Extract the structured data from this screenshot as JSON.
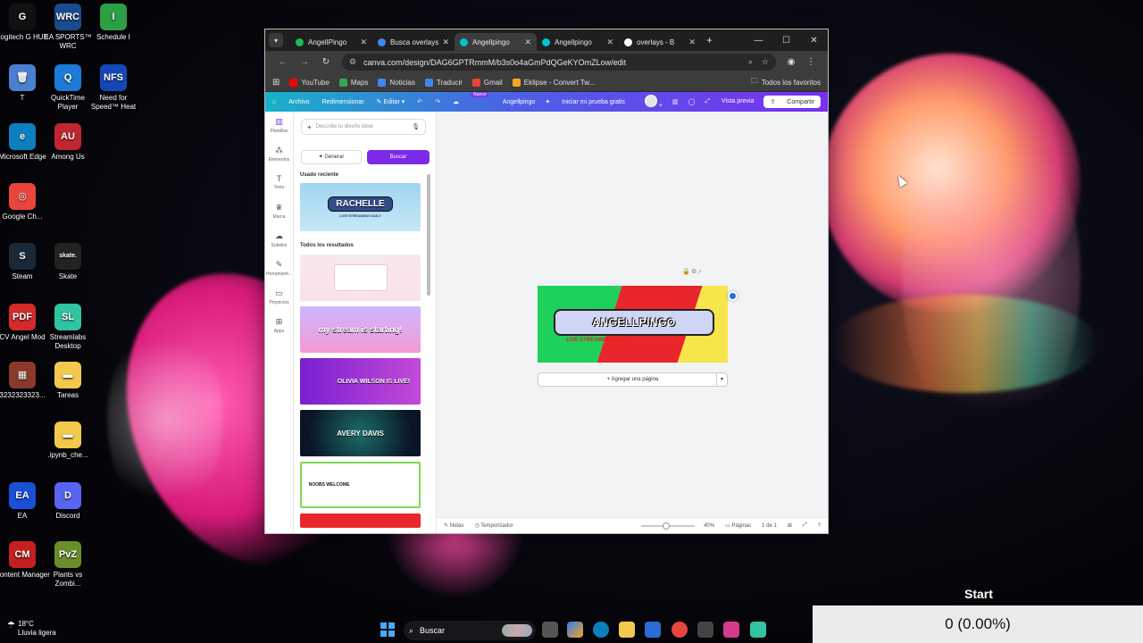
{
  "desktop": {
    "icons": [
      {
        "label": "Logitech G HUB",
        "color": "#111111",
        "glyph": "G"
      },
      {
        "label": "EA SPORTS™ WRC",
        "color": "#1a4b8c",
        "glyph": "WRC"
      },
      {
        "label": "Schedule I",
        "color": "#2e9e45",
        "glyph": "I"
      },
      {
        "label": "T",
        "color": "#4b7fcf",
        "glyph": "🗑"
      },
      {
        "label": "QuickTime Player",
        "color": "#1c7bd6",
        "glyph": "Q"
      },
      {
        "label": "Need for Speed™ Heat",
        "color": "#1448b8",
        "glyph": "NFS"
      },
      {
        "label": "Microsoft Edge",
        "color": "#0c7fbf",
        "glyph": "e"
      },
      {
        "label": "Among Us",
        "color": "#c0262d",
        "glyph": "AU"
      },
      {
        "label": "Google Ch...",
        "color": "#e8453c",
        "glyph": "◎"
      },
      {
        "label": "Steam",
        "color": "#1b2838",
        "glyph": "S"
      },
      {
        "label": "Skate",
        "color": "#222222",
        "glyph": "skate."
      },
      {
        "label": "CV Angel Mod",
        "color": "#d42a2a",
        "glyph": "PDF"
      },
      {
        "label": "Streamlabs Desktop",
        "color": "#31c3a2",
        "glyph": "SL"
      },
      {
        "label": "3232323323...",
        "color": "#8a3a2a",
        "glyph": "▦"
      },
      {
        "label": "Tareas",
        "color": "#f2c94c",
        "glyph": "▬"
      },
      {
        "label": ".ipynb_che...",
        "color": "#f2c94c",
        "glyph": "▬"
      },
      {
        "label": "EA",
        "color": "#1c4fd8",
        "glyph": "EA"
      },
      {
        "label": "Discord",
        "color": "#5865f2",
        "glyph": "D"
      },
      {
        "label": "Content Manager",
        "color": "#c42020",
        "glyph": "CM"
      },
      {
        "label": "Plants vs Zombi...",
        "color": "#6a8f2a",
        "glyph": "PvZ"
      }
    ]
  },
  "browser": {
    "tabs": [
      {
        "label": "AngelIPingo",
        "fav_color": "#1db954",
        "active": false
      },
      {
        "label": "Busca overlays",
        "fav_color": "#4285f4",
        "active": false
      },
      {
        "label": "Angellpingo",
        "fav_color": "#00c4cc",
        "active": true
      },
      {
        "label": "Angellpingo",
        "fav_color": "#00c4cc",
        "active": false
      },
      {
        "label": "overlays - B",
        "fav_color": "#ffffff",
        "active": false
      }
    ],
    "new_tab": "+",
    "controls": {
      "minimize": "—",
      "maximize": "☐",
      "close": "✕"
    },
    "url": "canva.com/design/DAG6GPTRmmM/b3s0o4aGmPdQGeKYOmZLow/edit",
    "bookmarks": [
      {
        "label": "YouTube",
        "color": "#ff0000"
      },
      {
        "label": "Maps",
        "color": "#34a853"
      },
      {
        "label": "Noticias",
        "color": "#4285f4"
      },
      {
        "label": "Traducir",
        "color": "#4285f4"
      },
      {
        "label": "Gmail",
        "color": "#ea4335"
      },
      {
        "label": "Eklipse - Convert Tw...",
        "color": "#f5a623"
      }
    ],
    "all_bookmarks": "Todos los favoritos"
  },
  "canva": {
    "toolbar": {
      "archivo": "Archivo",
      "redimensionar": "Redimensionar",
      "editar": "Editar",
      "nuevo": "Nuevo",
      "project_name": "Angellpingo",
      "trial": "Iniciar mi prueba gratis",
      "preview": "Vista previa",
      "share": "Compartir"
    },
    "rail": [
      {
        "label": "Plantillas",
        "icon": "▥"
      },
      {
        "label": "Elementos",
        "icon": "⁂"
      },
      {
        "label": "Texto",
        "icon": "T"
      },
      {
        "label": "Marca",
        "icon": "♛"
      },
      {
        "label": "Subidos",
        "icon": "☁"
      },
      {
        "label": "Herramient...",
        "icon": "✎"
      },
      {
        "label": "Proyectos",
        "icon": "▭"
      },
      {
        "label": "Apps",
        "icon": "⊞"
      }
    ],
    "panel": {
      "search_placeholder": "Describe tu diseño ideal",
      "generate": "Generar",
      "search_button": "Buscar",
      "recent_title": "Usado reciente",
      "results_title": "Todos los resultados",
      "thumbs": [
        {
          "text": "RACHELLE",
          "sub": "LIVE STREAMING DAILY"
        },
        {
          "text": ""
        },
        {
          "text": "my stream is starting!"
        },
        {
          "text": "OLIVIA WILSON IS LIVE!"
        },
        {
          "text": "AVERY DAVIS"
        },
        {
          "text": "NOOBS WELCOME"
        }
      ]
    },
    "design": {
      "title": "ANGELLPINGO",
      "subtitle": "LIVE STREAMING DAILY",
      "colors": {
        "green": "#1ed05c",
        "red": "#e8262b",
        "yellow": "#f6e54b"
      }
    },
    "add_page": "+ Agregar una página",
    "footer": {
      "notes": "Notas",
      "timer": "Temporizador",
      "zoom": "40%",
      "pages": "Páginas",
      "page_count": "1 de 1"
    }
  },
  "taskbar": {
    "weather_temp": "18°C",
    "weather_desc": "Lluvia ligera",
    "search": "Buscar"
  },
  "overlay": {
    "start_label": "Start",
    "counter": "0 (0.00%)"
  }
}
